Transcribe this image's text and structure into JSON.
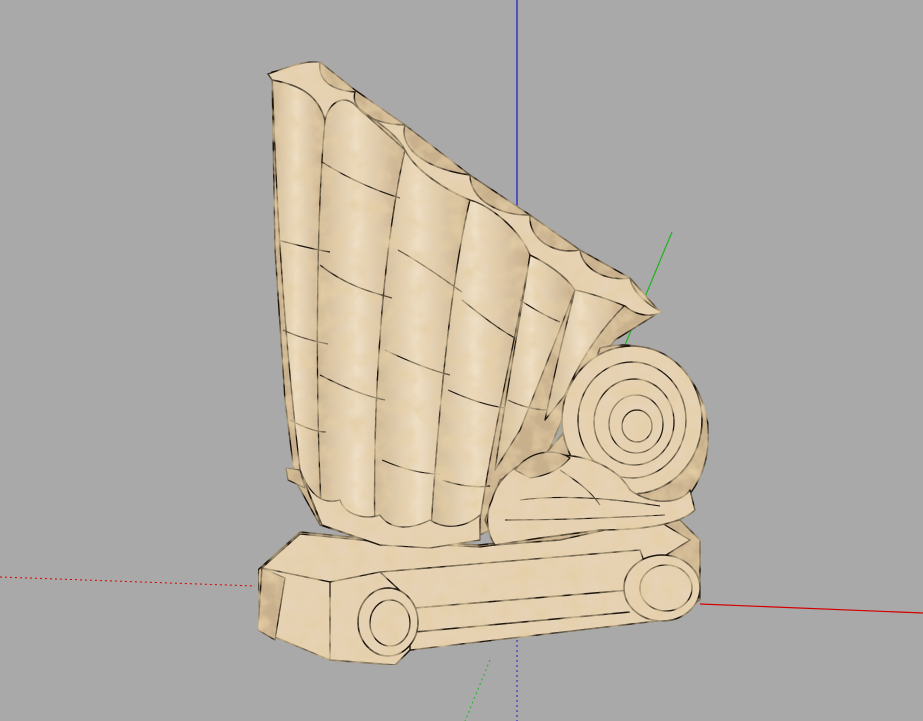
{
  "app": {
    "view": "3d-modeling-viewport",
    "background_color": "#a9a9a9"
  },
  "axes": {
    "red": "#d40000",
    "green": "#1fb31f",
    "blue": "#1a1acc"
  },
  "model": {
    "name": "ionic-capital-shell-ornament",
    "base_color": "#e6d2b4",
    "shade_color": "#c9b08d",
    "dark_color": "#8f7a5c",
    "edge_color": "#1c140c"
  }
}
